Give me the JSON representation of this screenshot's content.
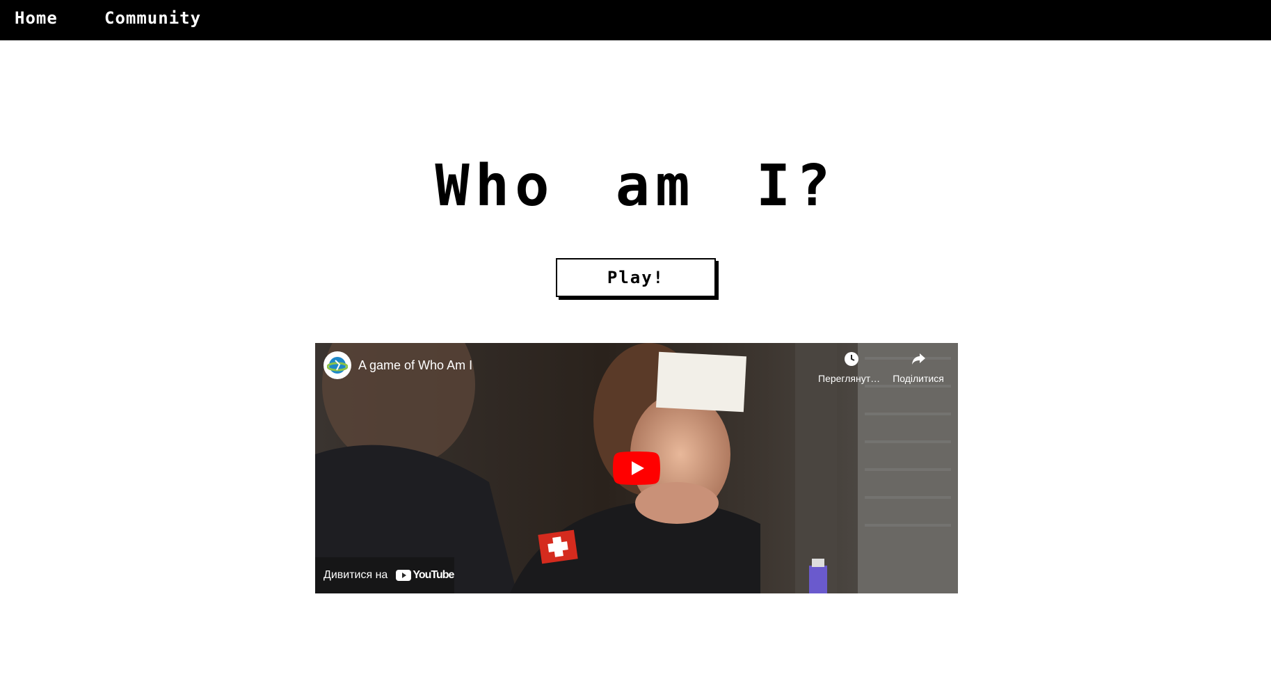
{
  "nav": {
    "home_label": "Home",
    "community_label": "Community"
  },
  "main": {
    "title": "Who am I?",
    "play_label": "Play!"
  },
  "video": {
    "title": "A game of Who Am I",
    "watch_later_label": "Переглянути пізніше",
    "share_label": "Поділитися",
    "watch_on_label": "Дивитися на",
    "platform_label": "YouTube",
    "icons": [
      "channel-logo-icon",
      "clock-icon",
      "share-icon",
      "youtube-play-icon",
      "youtube-logo-icon"
    ],
    "colors": {
      "play_button": "#ff0000"
    }
  },
  "colors": {
    "navbar": "#000000",
    "text": "#000000",
    "background": "#ffffff"
  }
}
